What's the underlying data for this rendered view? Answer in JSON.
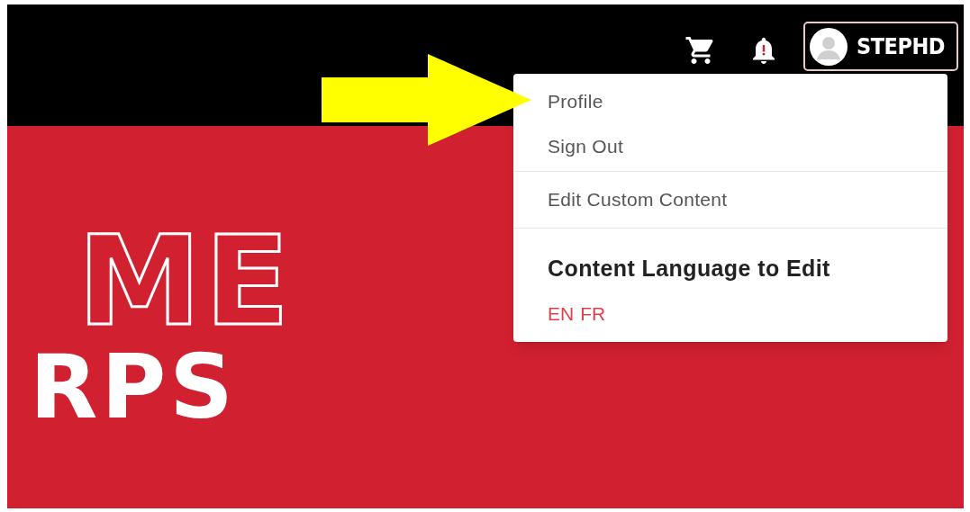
{
  "header": {
    "user_name": "STEPHD"
  },
  "hero": {
    "lines": [
      {
        "text": "ME",
        "kind": "outline"
      },
      {
        "text": "RPS",
        "kind": "solid"
      }
    ]
  },
  "menu": {
    "groups": [
      {
        "kind": "links",
        "items": [
          "Profile",
          "Sign Out"
        ]
      },
      {
        "kind": "links",
        "items": [
          "Edit Custom Content"
        ]
      },
      {
        "kind": "languages",
        "heading": "Content Language to Edit",
        "items": [
          "EN",
          "FR"
        ]
      }
    ]
  }
}
